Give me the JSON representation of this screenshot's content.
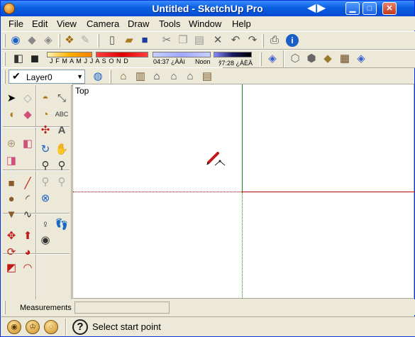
{
  "window": {
    "title": "Untitled - SketchUp Pro",
    "nav_left": "◀",
    "nav_right": "▶",
    "min": "▁",
    "max": "□",
    "close": "✕"
  },
  "menu": [
    "File",
    "Edit",
    "View",
    "Camera",
    "Draw",
    "Tools",
    "Window",
    "Help"
  ],
  "toolbar1": {
    "icons": [
      "getting-started-icon",
      "open-icon",
      "save-icon",
      "components-icon",
      "materials-icon",
      "new-icon",
      "open-file-icon",
      "save-file-icon",
      "cut-icon",
      "copy-icon",
      "paste-icon",
      "erase-icon",
      "undo-icon",
      "redo-icon",
      "print-icon",
      "model-info-icon"
    ]
  },
  "shadows": {
    "months": "J F M A M J J A S O N D",
    "time_start": "04:37 ¿ÀÀì",
    "noon": "Noon",
    "time_end": "ﾀ7:28 ¿ÀÈÄ"
  },
  "layer": {
    "name": "Layer0",
    "check": "✔",
    "arrow": "▼"
  },
  "viewport": {
    "view_name": "Top"
  },
  "measurements": {
    "label": "Measurements",
    "value": ""
  },
  "status": {
    "text": "Select start point",
    "help": "?"
  }
}
